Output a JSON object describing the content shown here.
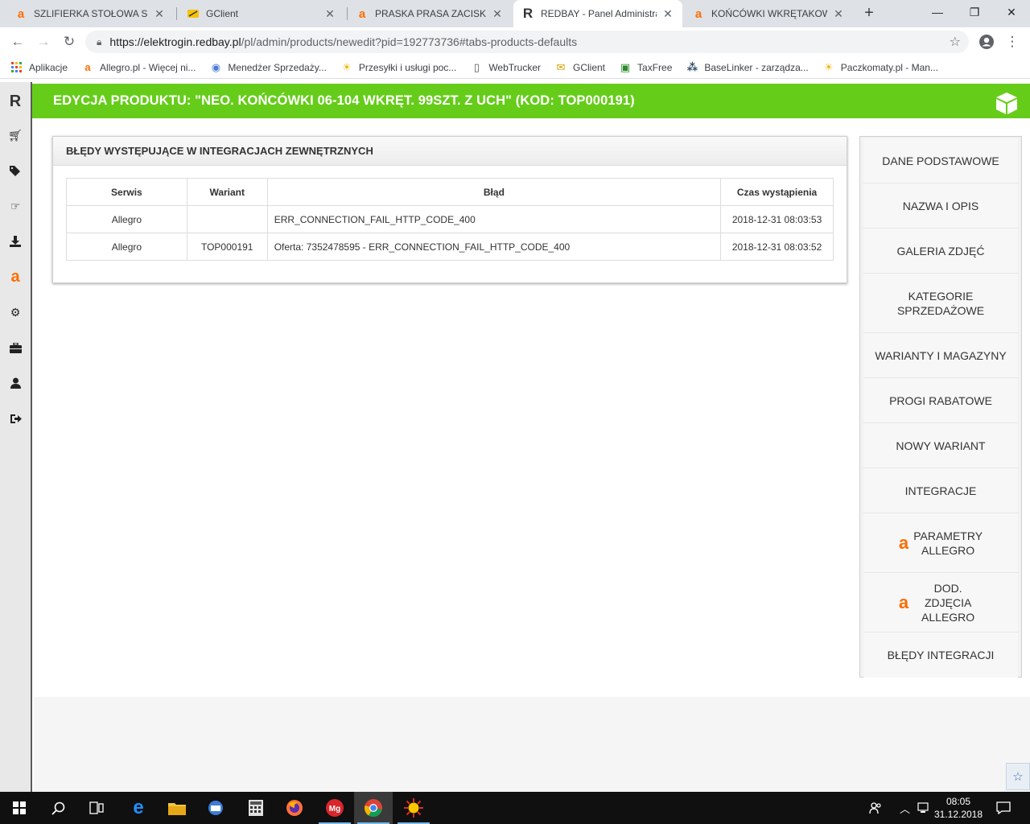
{
  "browser": {
    "tabs": [
      {
        "title": "SZLIFIERKA STOŁOWA SUCHA",
        "icon": "allegro-icon"
      },
      {
        "title": "GClient",
        "icon": "gclient-icon"
      },
      {
        "title": "PRASKA PRASA ZACISKARKA",
        "icon": "allegro-icon"
      },
      {
        "title": "REDBAY - Panel Administracyjny",
        "icon": "redbay-icon"
      },
      {
        "title": "KOŃCÓWKI WKRĘTAKOWE",
        "icon": "allegro-icon"
      }
    ],
    "url_main": "https://elektrogin.redbay.pl",
    "url_rest": "/pl/admin/products/newedit?pid=192773736#tabs-products-defaults",
    "bookmarks": [
      "Aplikacje",
      "Allegro.pl - Więcej ni...",
      "Menedżer Sprzedaży...",
      "Przesyłki i usługi poc...",
      "WebTrucker",
      "GClient",
      "TaxFree",
      "BaseLinker - zarządza...",
      "Paczkomaty.pl - Man..."
    ]
  },
  "page": {
    "title": "EDYCJA PRODUKTU: \"NEO. KOŃCÓWKI 06-104 WKRĘT. 99SZT. Z UCH\" (KOD: TOP000191)",
    "panel_title": "BŁĘDY WYSTĘPUJĄCE W INTEGRACJACH ZEWNĘTRZNYCH",
    "table": {
      "headers": [
        "Serwis",
        "Wariant",
        "Błąd",
        "Czas wystąpienia"
      ],
      "rows": [
        [
          "Allegro",
          "",
          "ERR_CONNECTION_FAIL_HTTP_CODE_400",
          "2018-12-31 08:03:53"
        ],
        [
          "Allegro",
          "TOP000191",
          "Oferta: 7352478595 - ERR_CONNECTION_FAIL_HTTP_CODE_400",
          "2018-12-31 08:03:52"
        ]
      ]
    },
    "right_menu": [
      {
        "label": "DANE PODSTAWOWE",
        "allegro": false
      },
      {
        "label": "NAZWA I OPIS",
        "allegro": false
      },
      {
        "label": "GALERIA ZDJĘĆ",
        "allegro": false
      },
      {
        "label": "KATEGORIE SPRZEDAŻOWE",
        "allegro": false
      },
      {
        "label": "WARIANTY I MAGAZYNY",
        "allegro": false
      },
      {
        "label": "PROGI RABATOWE",
        "allegro": false
      },
      {
        "label": "NOWY WARIANT",
        "allegro": false
      },
      {
        "label": "INTEGRACJE",
        "allegro": false
      },
      {
        "label": "PARAMETRY ALLEGRO",
        "allegro": true
      },
      {
        "label": "DOD. ZDJĘCIA ALLEGRO",
        "allegro": true
      },
      {
        "label": "BŁĘDY INTEGRACJI",
        "allegro": false
      }
    ]
  },
  "taskbar": {
    "time": "08:05",
    "date": "31.12.2018"
  },
  "colors": {
    "title_bar": "#66cc1a",
    "allegro_orange": "#ff6d00"
  }
}
